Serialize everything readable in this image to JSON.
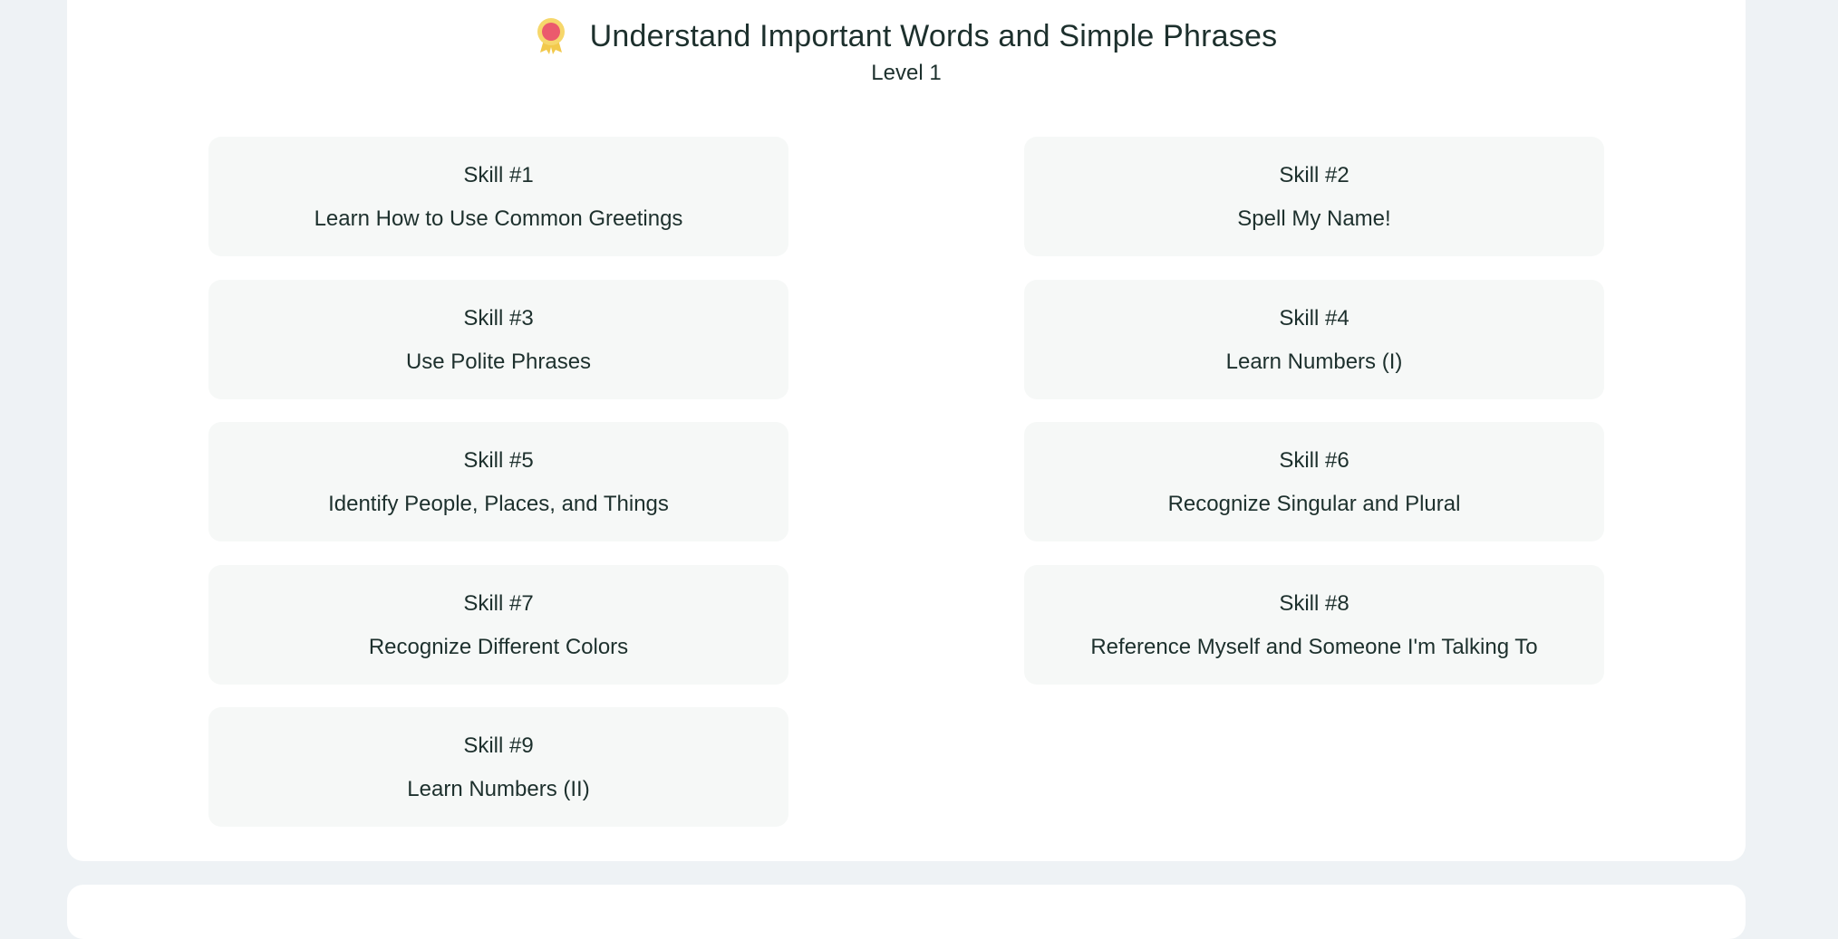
{
  "header": {
    "title": "Understand Important Words and Simple Phrases",
    "level": "Level 1",
    "icon": "medal-icon"
  },
  "colors": {
    "page_bg": "#eef2f5",
    "card_bg": "#ffffff",
    "skill_bg": "#f6f8f7",
    "text": "#1d302d",
    "medal_ribbon": "#f2c94c",
    "medal_center": "#eb5a6d"
  },
  "skills": [
    {
      "number": "Skill #1",
      "name": "Learn How to Use Common Greetings"
    },
    {
      "number": "Skill #2",
      "name": "Spell My Name!"
    },
    {
      "number": "Skill #3",
      "name": "Use Polite Phrases"
    },
    {
      "number": "Skill #4",
      "name": "Learn Numbers (I)"
    },
    {
      "number": "Skill #5",
      "name": "Identify People, Places, and Things"
    },
    {
      "number": "Skill #6",
      "name": "Recognize Singular and Plural"
    },
    {
      "number": "Skill #7",
      "name": "Recognize Different Colors"
    },
    {
      "number": "Skill #8",
      "name": "Reference Myself and Someone I'm Talking To"
    },
    {
      "number": "Skill #9",
      "name": "Learn Numbers (II)"
    }
  ]
}
